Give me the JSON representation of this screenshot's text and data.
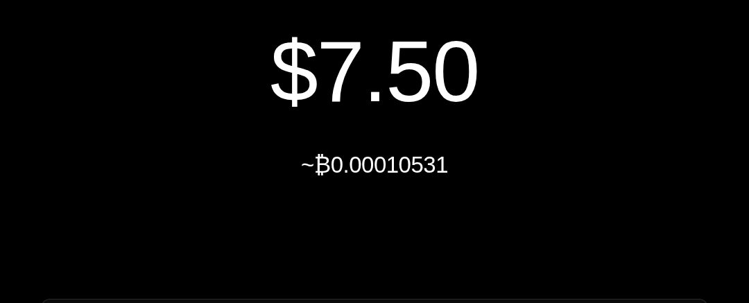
{
  "amount": "$7.50",
  "conversion": "~₿0.00010531"
}
